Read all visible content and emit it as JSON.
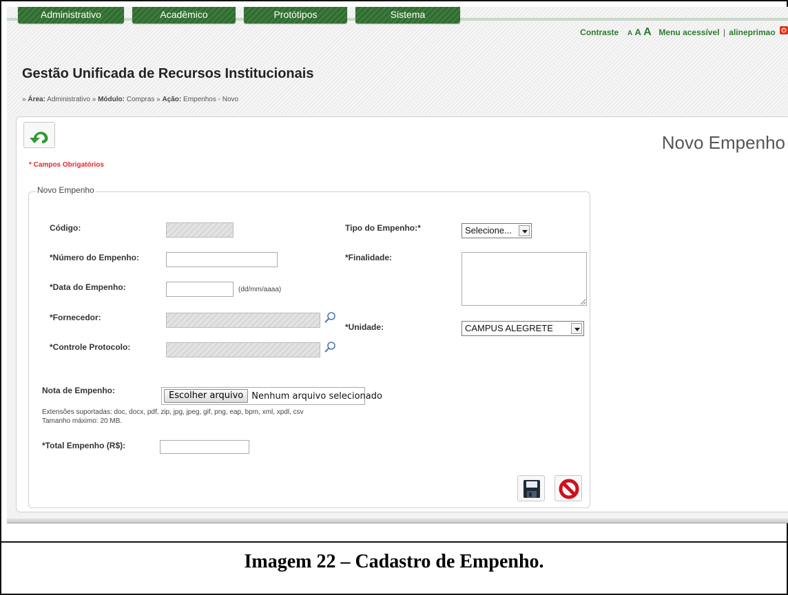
{
  "nav": {
    "tabs": [
      "Administrativo",
      "Acadêmico",
      "Protótipos",
      "Sistema"
    ]
  },
  "top_links": {
    "contrast": "Contraste",
    "font_small": "A",
    "font_medium": "A",
    "font_large": "A",
    "accessible_menu": "Menu acessível",
    "separator": "|",
    "username": "alineprimao"
  },
  "header": {
    "title": "Gestão Unificada de Recursos Institucionais",
    "breadcrumb": {
      "prefix": "»",
      "area_label": "Área:",
      "area_value": "Administrativo",
      "sep1": "»",
      "module_label": "Módulo:",
      "module_value": "Compras",
      "sep2": "»",
      "action_label": "Ação:",
      "action_value": "Empenhos - Novo"
    }
  },
  "page": {
    "heading": "Novo Empenho",
    "required_note": "* Campos Obrigatórios",
    "legend": "Novo Empenho"
  },
  "form": {
    "codigo_label": "Código:",
    "numero_label": "*Número do Empenho:",
    "data_label": "*Data do Empenho:",
    "data_hint": "(dd/mm/aaaa)",
    "fornecedor_label": "*Fornecedor:",
    "protocolo_label": "*Controle Protocolo:",
    "tipo_label": "Tipo do Empenho:*",
    "tipo_value": "Selecione...",
    "finalidade_label": "*Finalidade:",
    "unidade_label": "*Unidade:",
    "unidade_value": "CAMPUS ALEGRETE",
    "nota_label": "Nota de Empenho:",
    "file_button": "Escolher arquivo",
    "file_status": "Nenhum arquivo selecionado",
    "extensions": "Extensões suportadas: doc, docx, pdf, zip, jpg, jpeg, gif, png, eap, bpm, xml, xpdl, csv",
    "max_size": "Tamanho máximo: 20 MB.",
    "total_label": "*Total Empenho (R$):"
  },
  "caption": "Imagem 22 – Cadastro de Empenho.",
  "colors": {
    "nav_green": "#3e7a3e",
    "link_green": "#2f7a2f",
    "required_red": "#e8242a",
    "cancel_red": "#d0101a"
  },
  "icons": [
    "back-arrow-icon",
    "search-icon",
    "save-icon",
    "cancel-icon",
    "logout-icon"
  ]
}
